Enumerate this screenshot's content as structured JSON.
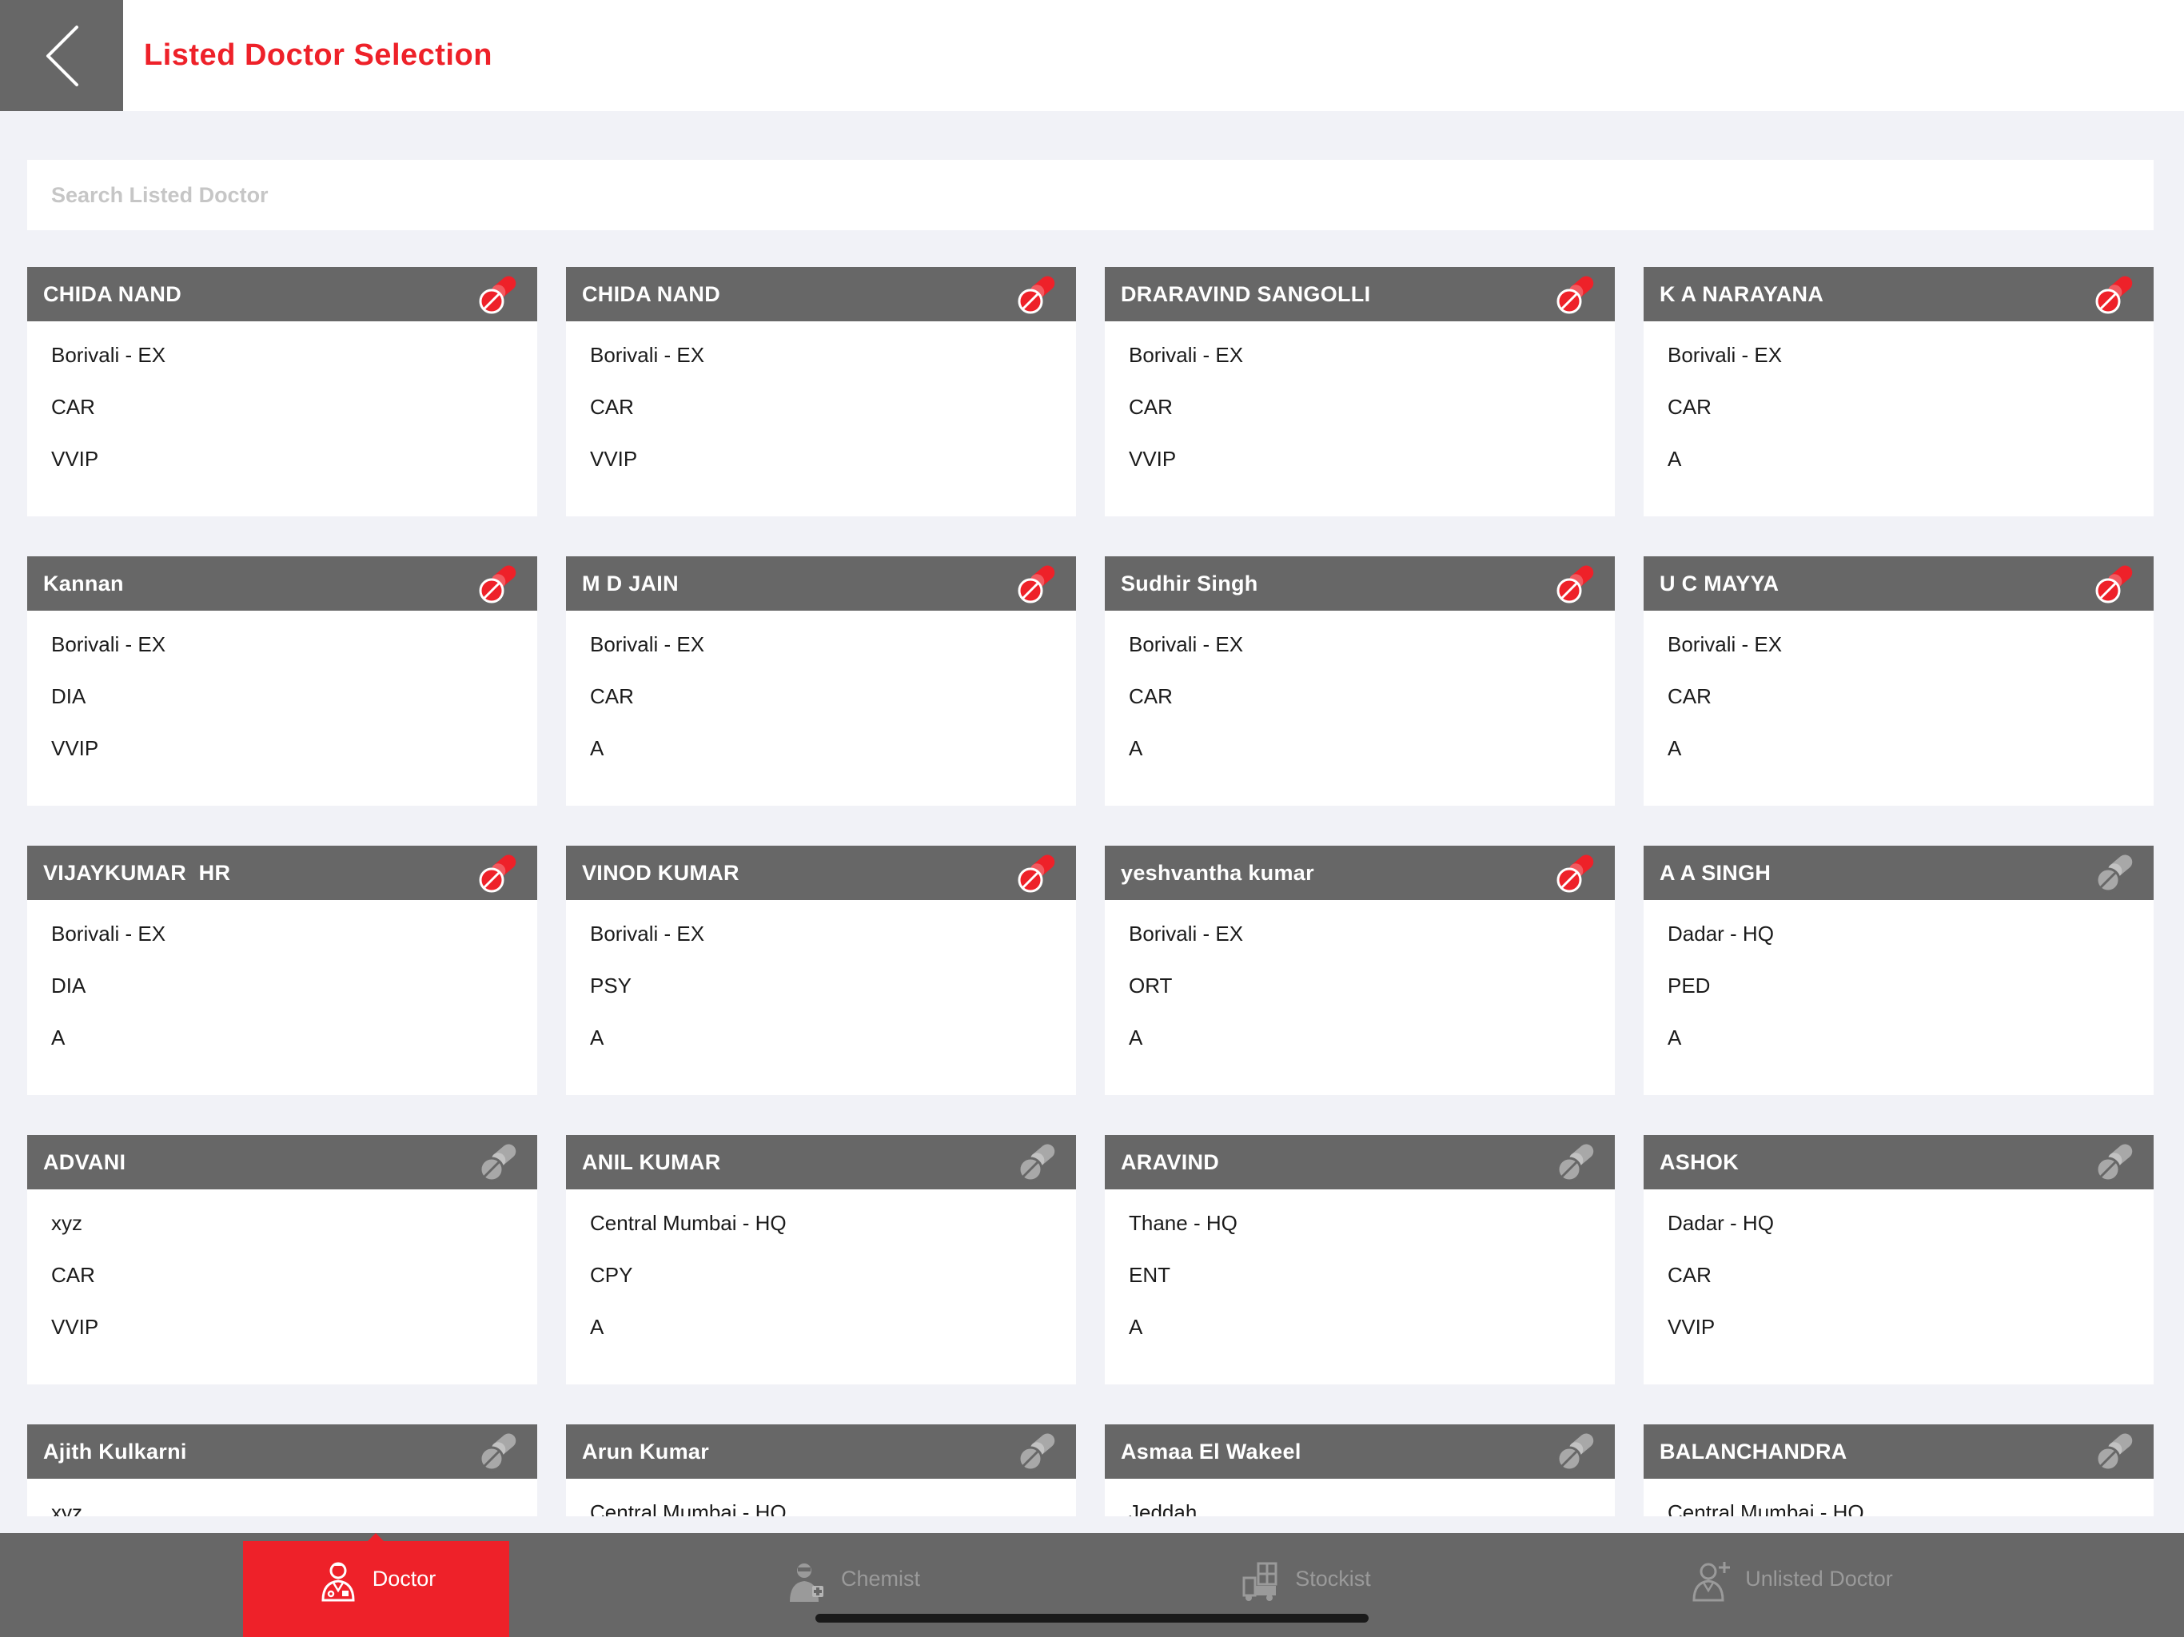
{
  "header": {
    "title": "Listed Doctor Selection",
    "back_icon": "chevron-left-icon"
  },
  "search": {
    "placeholder": "Search Listed Doctor",
    "value": ""
  },
  "colors": {
    "accent": "#ee2129",
    "header_gray": "#676767",
    "background": "#f1f2f7",
    "inactive_icon": "#a8a8a8"
  },
  "doctors": [
    {
      "name": "CHIDA NAND",
      "area": "Borivali - EX",
      "speciality": "CAR",
      "category": "VVIP",
      "product_icon_state": "active"
    },
    {
      "name": "CHIDA NAND",
      "area": "Borivali - EX",
      "speciality": "CAR",
      "category": "VVIP",
      "product_icon_state": "active"
    },
    {
      "name": "DRARAVIND SANGOLLI",
      "area": "Borivali - EX",
      "speciality": "CAR",
      "category": "VVIP",
      "product_icon_state": "active"
    },
    {
      "name": "K A NARAYANA",
      "area": "Borivali - EX",
      "speciality": "CAR",
      "category": "A",
      "product_icon_state": "active"
    },
    {
      "name": "Kannan",
      "area": "Borivali - EX",
      "speciality": "DIA",
      "category": "VVIP",
      "product_icon_state": "active"
    },
    {
      "name": "M D JAIN",
      "area": "Borivali - EX",
      "speciality": "CAR",
      "category": "A",
      "product_icon_state": "active"
    },
    {
      "name": "Sudhir Singh",
      "area": "Borivali - EX",
      "speciality": "CAR",
      "category": "A",
      "product_icon_state": "active"
    },
    {
      "name": "U C MAYYA",
      "area": "Borivali - EX",
      "speciality": "CAR",
      "category": "A",
      "product_icon_state": "active"
    },
    {
      "name": "VIJAYKUMAR  HR",
      "area": "Borivali - EX",
      "speciality": "DIA",
      "category": "A",
      "product_icon_state": "active"
    },
    {
      "name": "VINOD KUMAR",
      "area": "Borivali - EX",
      "speciality": "PSY",
      "category": "A",
      "product_icon_state": "active"
    },
    {
      "name": "yeshvantha kumar",
      "area": "Borivali - EX",
      "speciality": "ORT",
      "category": "A",
      "product_icon_state": "active"
    },
    {
      "name": "A A SINGH",
      "area": "Dadar - HQ",
      "speciality": "PED",
      "category": "A",
      "product_icon_state": "inactive"
    },
    {
      "name": "ADVANI",
      "area": "xyz",
      "speciality": "CAR",
      "category": "VVIP",
      "product_icon_state": "inactive"
    },
    {
      "name": "ANIL KUMAR",
      "area": "Central Mumbai - HQ",
      "speciality": "CPY",
      "category": "A",
      "product_icon_state": "inactive"
    },
    {
      "name": "ARAVIND",
      "area": "Thane - HQ",
      "speciality": "ENT",
      "category": "A",
      "product_icon_state": "inactive"
    },
    {
      "name": "ASHOK",
      "area": "Dadar - HQ",
      "speciality": "CAR",
      "category": "VVIP",
      "product_icon_state": "inactive"
    },
    {
      "name": "Ajith Kulkarni",
      "area": "xyz",
      "speciality": "",
      "category": "",
      "product_icon_state": "inactive"
    },
    {
      "name": "Arun Kumar",
      "area": "Central Mumbai - HQ",
      "speciality": "",
      "category": "",
      "product_icon_state": "inactive"
    },
    {
      "name": "Asmaa El Wakeel",
      "area": "Jeddah",
      "speciality": "",
      "category": "",
      "product_icon_state": "inactive"
    },
    {
      "name": "BALANCHANDRA",
      "area": "Central Mumbai - HQ",
      "speciality": "",
      "category": "",
      "product_icon_state": "inactive"
    }
  ],
  "tabs": [
    {
      "label": "Doctor",
      "icon": "doctor-icon",
      "active": true
    },
    {
      "label": "Chemist",
      "icon": "chemist-icon",
      "active": false
    },
    {
      "label": "Stockist",
      "icon": "stockist-icon",
      "active": false
    },
    {
      "label": "Unlisted Doctor",
      "icon": "unlisted-doctor-icon",
      "active": false
    }
  ]
}
